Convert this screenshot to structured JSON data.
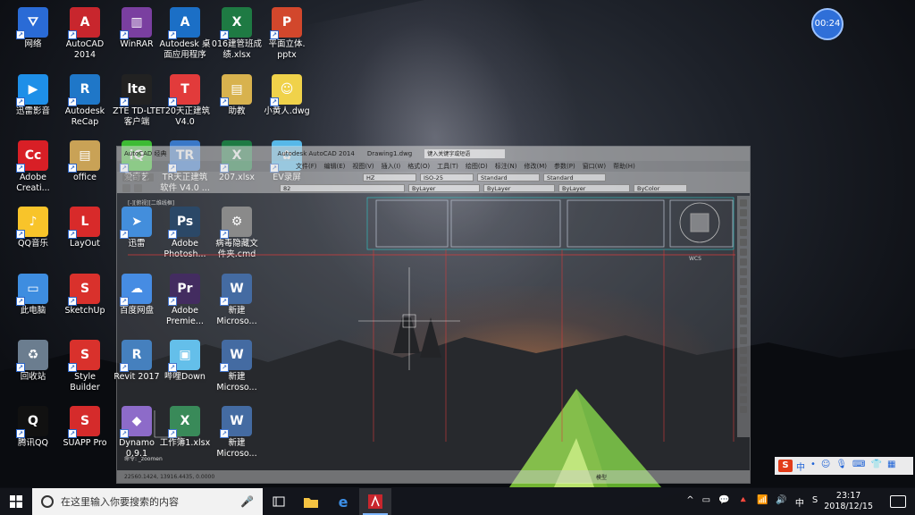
{
  "desktop": {
    "icons": [
      {
        "label": "网络",
        "color": "#2a6bd6",
        "glyph": "⛛"
      },
      {
        "label": "迅雷影音",
        "color": "#1e8fe8",
        "glyph": "▶"
      },
      {
        "label": "Adobe\nCreati...",
        "color": "#d81f26",
        "glyph": "Cc"
      },
      {
        "label": "QQ音乐",
        "color": "#f8c42a",
        "glyph": "♪"
      },
      {
        "label": "此电脑",
        "color": "#3e8de0",
        "glyph": "▭"
      },
      {
        "label": "回收站",
        "color": "#6b7d8f",
        "glyph": "♻"
      },
      {
        "label": "腾讯QQ",
        "color": "#111",
        "glyph": "Q"
      },
      {
        "label": "AutoCAD\n2014",
        "color": "#c8262d",
        "glyph": "A"
      },
      {
        "label": "Autodesk\nReCap",
        "color": "#1f77c8",
        "glyph": "R"
      },
      {
        "label": "office",
        "color": "#c9a256",
        "glyph": "▤"
      },
      {
        "label": "LayOut",
        "color": "#d82a2a",
        "glyph": "L"
      },
      {
        "label": "SketchUp",
        "color": "#d9312c",
        "glyph": "S"
      },
      {
        "label": "Style\nBuilder",
        "color": "#d9312c",
        "glyph": "S"
      },
      {
        "label": "SUAPP Pro",
        "color": "#d52b2b",
        "glyph": "S"
      },
      {
        "label": "WinRAR",
        "color": "#7a3fa0",
        "glyph": "▥"
      },
      {
        "label": "ZTE TD-LTE\n客户端",
        "color": "#222",
        "glyph": "lte"
      },
      {
        "label": "爱奇艺",
        "color": "#3dbb34",
        "glyph": "iQ"
      },
      {
        "label": "迅雷",
        "color": "#2a7fd8",
        "glyph": "➤"
      },
      {
        "label": "百度网盘",
        "color": "#2d7de0",
        "glyph": "☁"
      },
      {
        "label": "Revit 2017",
        "color": "#2c6fb5",
        "glyph": "R"
      },
      {
        "label": "Dynamo\n0.9.1",
        "color": "#7e57c2",
        "glyph": "◆"
      },
      {
        "label": "Autodesk 桌\n面应用程序",
        "color": "#1b6fc6",
        "glyph": "A"
      },
      {
        "label": "T20天正建筑\nV4.0",
        "color": "#e23b3b",
        "glyph": "T"
      },
      {
        "label": "TR天正建筑\n软件 V4.0 ...",
        "color": "#3a78c8",
        "glyph": "TR"
      },
      {
        "label": "Adobe\nPhotosh...",
        "color": "#0e2f52",
        "glyph": "Ps"
      },
      {
        "label": "Adobe\nPremie...",
        "color": "#2a0f4a",
        "glyph": "Pr"
      },
      {
        "label": "哔哩Down",
        "color": "#4fb7e8",
        "glyph": "▣"
      },
      {
        "label": "工作簿1.xlsx",
        "color": "#1e7a43",
        "glyph": "X"
      },
      {
        "label": "016建管班成\n绩.xlsx",
        "color": "#1e7a43",
        "glyph": "X"
      },
      {
        "label": "助教",
        "color": "#d8b24e",
        "glyph": "▤"
      },
      {
        "label": "207.xlsx",
        "color": "#1e7a43",
        "glyph": "X"
      },
      {
        "label": "病毒隐藏文\n件夹.cmd",
        "color": "#7a7a7a",
        "glyph": "⚙"
      },
      {
        "label": "新建\nMicroso...",
        "color": "#2b5796",
        "glyph": "W"
      },
      {
        "label": "新建\nMicroso...",
        "color": "#2b5796",
        "glyph": "W"
      },
      {
        "label": "新建\nMicroso...",
        "color": "#2b5796",
        "glyph": "W"
      },
      {
        "label": "平面立体.\npptx",
        "color": "#d2472c",
        "glyph": "P"
      },
      {
        "label": "小黄人.dwg",
        "color": "#f0d24a",
        "glyph": "☺"
      },
      {
        "label": "EV录屏",
        "color": "#57b8e8",
        "glyph": "✿"
      }
    ]
  },
  "autocad": {
    "title": "Autodesk AutoCAD 2014",
    "doc": "Drawing1.dwg",
    "search_placeholder": "键入关键字或短语",
    "app_label": "AutoCAD 经典",
    "layer": "82",
    "layer_color": "ByLayer",
    "linetype": "ByLayer",
    "lineweight": "ByLayer",
    "text_style": "Standard",
    "dim_style": "ISO-25",
    "table_style": "Standard",
    "ml_style": "Standard",
    "plot_style": "ByColor",
    "layer_state": "HZ",
    "menu": [
      "文件(F)",
      "编辑(E)",
      "视图(V)",
      "插入(I)",
      "格式(O)",
      "工具(T)",
      "绘图(D)",
      "标注(N)",
      "修改(M)",
      "参数(P)",
      "窗口(W)",
      "帮助(H)"
    ],
    "view_label": "[-][俯视][二维线框]",
    "coords": "22560.1424, 13916.4435, 0.0000",
    "command": "命令: _zoomen",
    "model_tab": "模型"
  },
  "timer": "00:24",
  "ime": {
    "s": "S",
    "items": [
      "中",
      "•",
      "☺",
      "🎙",
      "⌨",
      "👕",
      "▦"
    ]
  },
  "taskbar": {
    "search_placeholder": "在这里输入你要搜索的内容",
    "time": "23:17",
    "date": "2018/12/15",
    "tray": [
      "^",
      "▭",
      "💬",
      "🔺",
      "📶",
      "🔊",
      "中",
      "S"
    ]
  }
}
